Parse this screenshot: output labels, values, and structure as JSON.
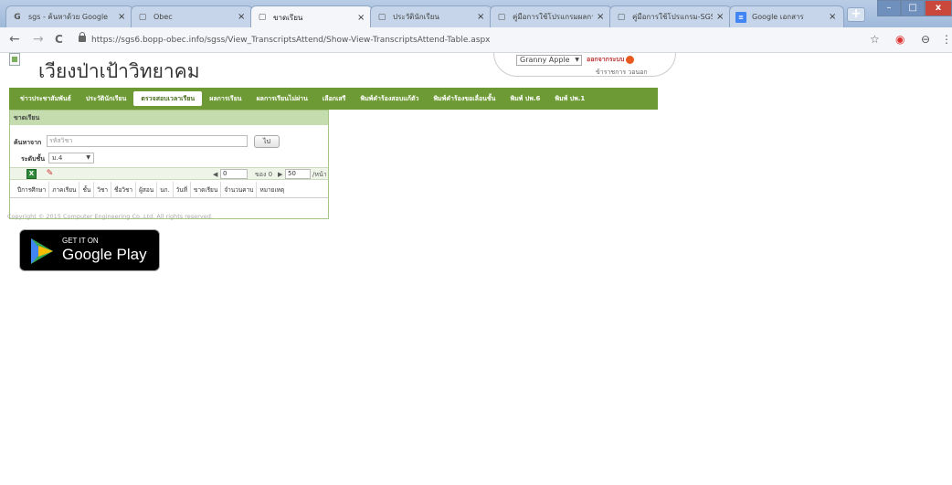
{
  "browser": {
    "tabs": [
      {
        "title": "sgs - ค้นหาด้วย Google",
        "icon": "G",
        "active": false
      },
      {
        "title": "Obec",
        "icon": "",
        "active": false
      },
      {
        "title": "ขาดเรียน",
        "icon": "",
        "active": true
      },
      {
        "title": "ประวัตินักเรียน",
        "icon": "",
        "active": false
      },
      {
        "title": "คู่มือการใช้โปรแกรมผลการเรียน",
        "icon": "",
        "active": false
      },
      {
        "title": "คู่มือการใช้โปรแกรม-SGS-ส",
        "icon": "",
        "active": false
      },
      {
        "title": "Google เอกสาร",
        "icon": "",
        "active": false
      }
    ],
    "tab_close": "×",
    "new_tab": "+",
    "url": "https://sgs6.bopp-obec.info/sgss/View_TranscriptsAttend/Show-View-TranscriptsAttend-Table.aspx",
    "nav": {
      "back": "←",
      "forward": "→",
      "reload": "C"
    },
    "toolbar_icons": {
      "star": "☆",
      "ext": "◉",
      "profile": "⊖",
      "menu": "⋮"
    },
    "window_controls": {
      "minimize": "–",
      "maximize": "□",
      "close": "x"
    }
  },
  "header": {
    "school_name": "เวียงป่าเป้าวิทยาคม",
    "user_select": "Granny Apple",
    "logout": "ออกจากระบบ",
    "role": "ข้าราชการ วอนอก"
  },
  "menu": [
    {
      "label": "ข่าวประชาสัมพันธ์",
      "active": false
    },
    {
      "label": "ประวัตินักเรียน",
      "active": false
    },
    {
      "label": "ตรวจสอบเวลาเรียน",
      "active": true
    },
    {
      "label": "ผลการเรียน",
      "active": false
    },
    {
      "label": "ผลการเรียนไม่ผ่าน",
      "active": false
    },
    {
      "label": "เลือกเสรี",
      "active": false
    },
    {
      "label": "พิมพ์คำร้องสอบแก้ตัว",
      "active": false
    },
    {
      "label": "พิมพ์คำร้องขอเลื่อนชั้น",
      "active": false
    },
    {
      "label": "พิมพ์ ปพ.6",
      "active": false
    },
    {
      "label": "พิมพ์ ปพ.1",
      "active": false
    }
  ],
  "panel": {
    "title": "ขาดเรียน",
    "search_label": "ค้นหาจาก",
    "search_placeholder": "รหัสวิชา",
    "go_button": "ไป",
    "level_label": "ระดับชั้น",
    "level_value": "ม.4",
    "pager": {
      "page": "0",
      "of_label": "ของ 0",
      "page_size": "50",
      "per_page": "/หน้า"
    },
    "columns": [
      "ปีการศึกษา",
      "ภาคเรียน",
      "ชั้น",
      "วิชา",
      "ชื่อวิชา",
      "ผู้สอน",
      "นก.",
      "วันที่",
      "ขาดเรียน",
      "จำนวนคาบ",
      "หมายเหตุ"
    ]
  },
  "footer": {
    "copyright": "Copyright © 2015 Computer Engineering Co.,Ltd. All rights reserved.",
    "gplay_small": "GET IT ON",
    "gplay_big": "Google Play"
  },
  "colors": {
    "menu_green": "#6e9a35",
    "panel_head": "#c4dcae"
  }
}
